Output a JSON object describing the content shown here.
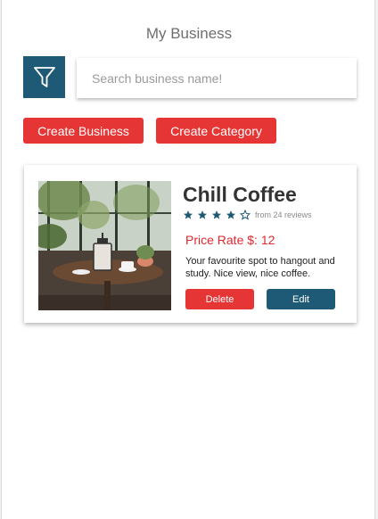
{
  "page": {
    "title": "My Business"
  },
  "search": {
    "placeholder": "Search business name!",
    "value": ""
  },
  "filter_icon": "filter-funnel-icon",
  "actions": {
    "create_business": "Create Business",
    "create_category": "Create Category"
  },
  "business_card": {
    "name": "Chill Coffee",
    "rating": 4,
    "rating_max": 5,
    "reviews_text": "from 24 reviews",
    "price_rate": "Price Rate $: 12",
    "description": "Your favourite spot to hangout and study. Nice view, nice coffee.",
    "delete_label": "Delete",
    "edit_label": "Edit"
  },
  "colors": {
    "primary_dark": "#1e5a75",
    "accent_red": "#e53535",
    "price_red": "#e0282e"
  }
}
